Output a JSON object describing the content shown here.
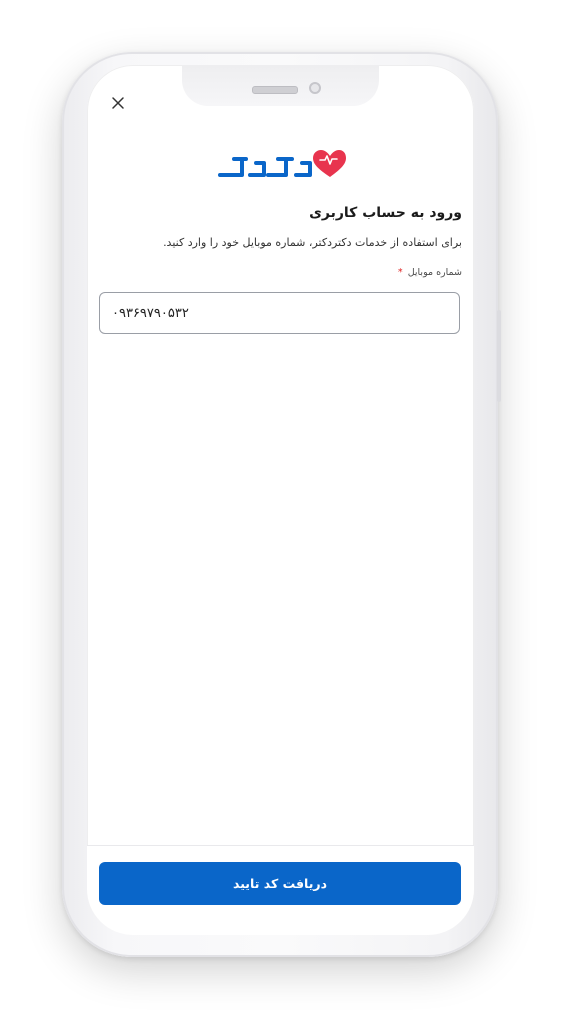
{
  "app": {
    "brand_logo_text": "دکتردکتر"
  },
  "header": {
    "close_icon": "close-icon"
  },
  "login": {
    "title": "ورود به حساب کاربری",
    "subtitle": "برای استفاده از خدمات دکتردکتر، شماره موبایل خود را وارد کنید.",
    "phone_label": "شماره موبایل",
    "required_mark": "*",
    "phone_value": "۰۹۳۶۹۷۹۰۵۳۲"
  },
  "footer": {
    "submit_label": "دریافت کد تایید"
  },
  "colors": {
    "brand_blue": "#0a66c9",
    "heart_red": "#e8344e",
    "required_red": "#e02424"
  }
}
